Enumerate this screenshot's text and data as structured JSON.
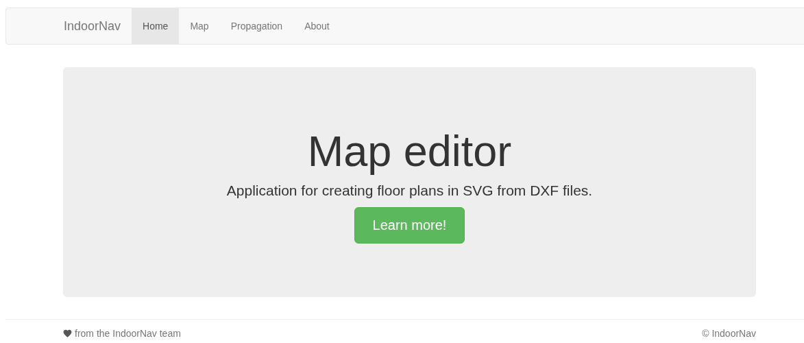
{
  "navbar": {
    "brand": "IndoorNav",
    "items": [
      {
        "label": "Home",
        "selected": true
      },
      {
        "label": "Map",
        "selected": false
      },
      {
        "label": "Propagation",
        "selected": false
      },
      {
        "label": "About",
        "selected": false
      }
    ]
  },
  "hero": {
    "title": "Map editor",
    "text": "Application for creating floor plans in SVG from DXF files.",
    "button": "Learn more!"
  },
  "footer": {
    "left": "from the IndoorNav team",
    "right": "© IndoorNav"
  }
}
